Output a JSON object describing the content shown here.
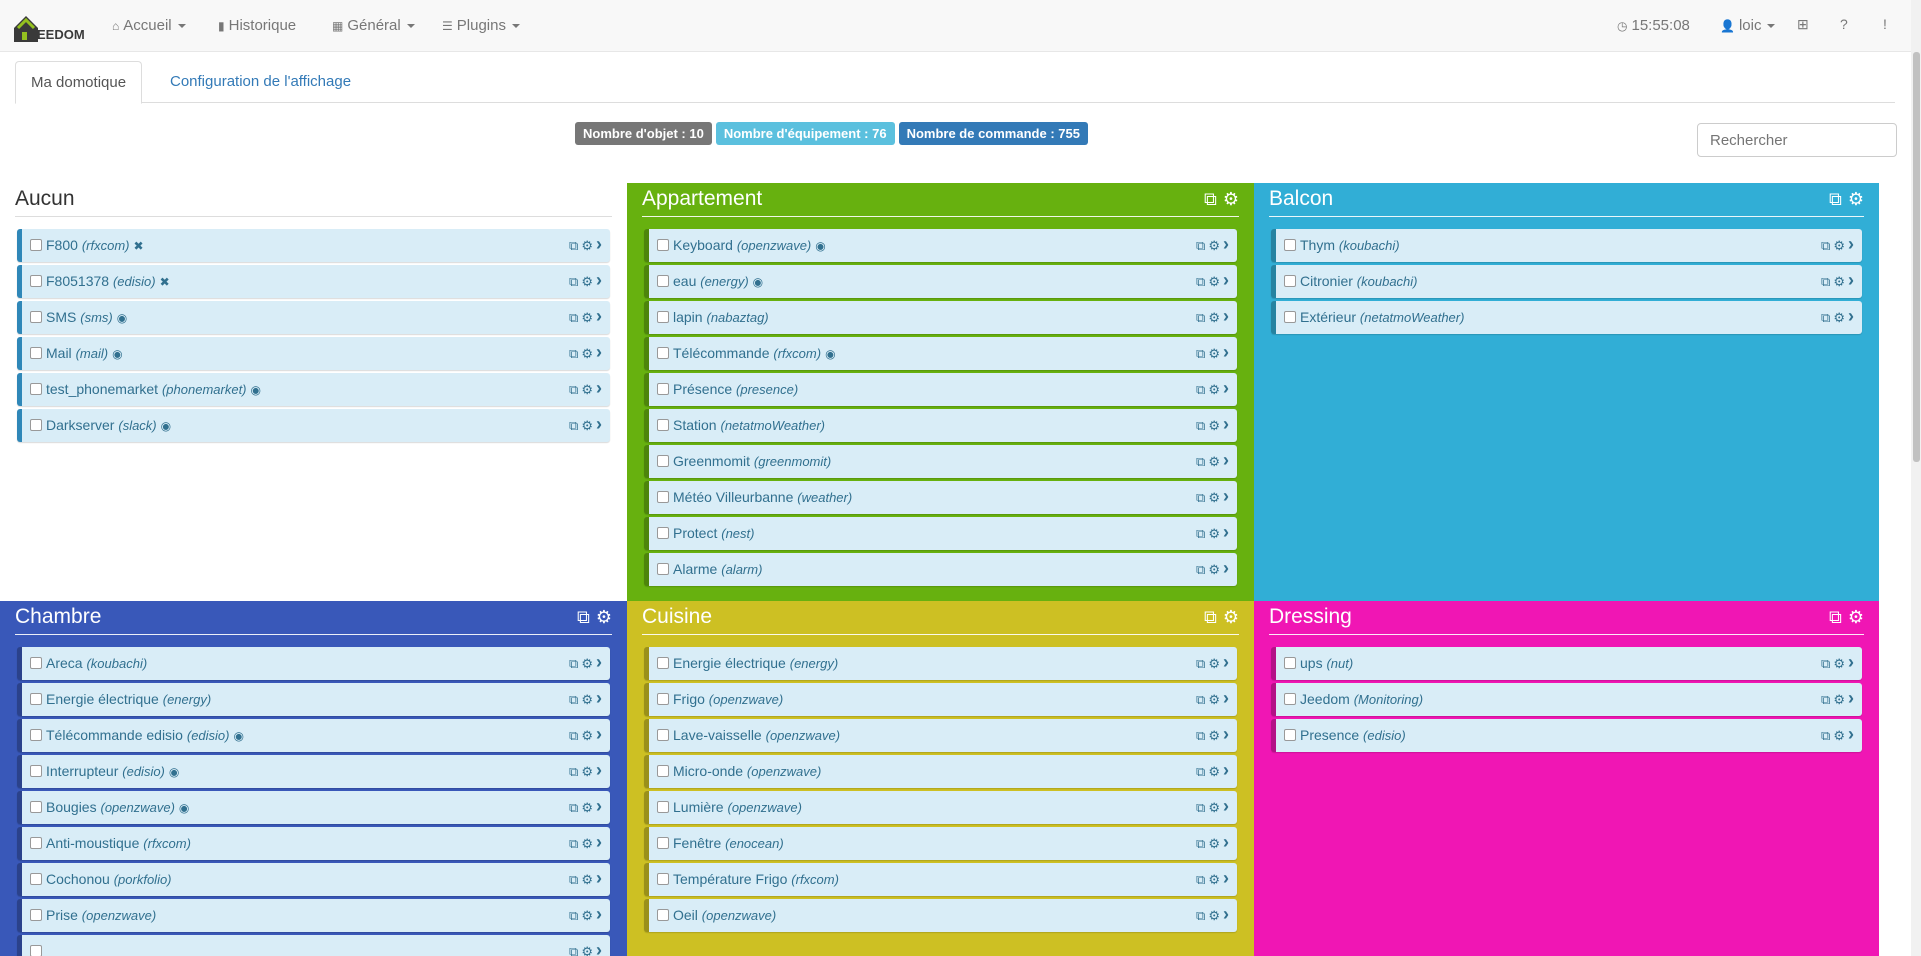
{
  "navbar": {
    "logo_text": "EEDOM",
    "menu": [
      {
        "icon": "home-icon",
        "glyph": "⌂",
        "label": "Accueil",
        "dropdown": true
      },
      {
        "icon": "bar-chart-icon",
        "glyph": "▮",
        "label": "Historique",
        "dropdown": false
      },
      {
        "icon": "dashboard-icon",
        "glyph": "▦",
        "label": "Général",
        "dropdown": true
      },
      {
        "icon": "list-icon",
        "glyph": "☰",
        "label": "Plugins",
        "dropdown": true
      }
    ],
    "clock": "15:55:08",
    "user": "loic"
  },
  "tabs": [
    {
      "label": "Ma domotique",
      "active": true
    },
    {
      "label": "Configuration de l'affichage",
      "active": false
    }
  ],
  "counters": [
    {
      "label": "Nombre d'objet : 10",
      "color": "#777777"
    },
    {
      "label": "Nombre d'équipement : 76",
      "color": "#5bc0de"
    },
    {
      "label": "Nombre de commande : 755",
      "color": "#337ab7"
    }
  ],
  "search": {
    "placeholder": "Rechercher"
  },
  "objects": [
    {
      "name": "Aucun",
      "color": "#ffffff",
      "plain": true,
      "show_head_icons": false,
      "equipments": [
        {
          "name": "F800",
          "type": "(rfxcom)",
          "status": "✖"
        },
        {
          "name": "F8051378",
          "type": "(edisio)",
          "status": "✖"
        },
        {
          "name": "SMS",
          "type": "(sms)",
          "status": "◉"
        },
        {
          "name": "Mail",
          "type": "(mail)",
          "status": "◉"
        },
        {
          "name": "test_phonemarket",
          "type": "(phonemarket)",
          "status": "◉"
        },
        {
          "name": "Darkserver",
          "type": "(slack)",
          "status": "◉"
        }
      ]
    },
    {
      "name": "Appartement",
      "color": "#67b10f",
      "plain": false,
      "show_head_icons": true,
      "equipments": [
        {
          "name": "Keyboard",
          "type": "(openzwave)",
          "status": "◉"
        },
        {
          "name": "eau",
          "type": "(energy)",
          "status": "◉"
        },
        {
          "name": "lapin",
          "type": "(nabaztag)",
          "status": ""
        },
        {
          "name": "Télécommande",
          "type": "(rfxcom)",
          "status": "◉"
        },
        {
          "name": "Présence",
          "type": "(presence)",
          "status": ""
        },
        {
          "name": "Station",
          "type": "(netatmoWeather)",
          "status": ""
        },
        {
          "name": "Greenmomit",
          "type": "(greenmomit)",
          "status": ""
        },
        {
          "name": "Météo Villeurbanne",
          "type": "(weather)",
          "status": ""
        },
        {
          "name": "Protect",
          "type": "(nest)",
          "status": ""
        },
        {
          "name": "Alarme",
          "type": "(alarm)",
          "status": ""
        }
      ]
    },
    {
      "name": "Balcon",
      "color": "#31aed6",
      "plain": false,
      "show_head_icons": true,
      "equipments": [
        {
          "name": "Thym",
          "type": "(koubachi)",
          "status": ""
        },
        {
          "name": "Citronier",
          "type": "(koubachi)",
          "status": ""
        },
        {
          "name": "Extérieur",
          "type": "(netatmoWeather)",
          "status": ""
        }
      ]
    },
    {
      "name": "Chambre",
      "color": "#3958b9",
      "plain": false,
      "show_head_icons": true,
      "equipments": [
        {
          "name": "Areca",
          "type": "(koubachi)",
          "status": ""
        },
        {
          "name": "Energie électrique",
          "type": "(energy)",
          "status": ""
        },
        {
          "name": "Télécommande edisio",
          "type": "(edisio)",
          "status": "◉"
        },
        {
          "name": "Interrupteur",
          "type": "(edisio)",
          "status": "◉"
        },
        {
          "name": "Bougies",
          "type": "(openzwave)",
          "status": "◉"
        },
        {
          "name": "Anti-moustique",
          "type": "(rfxcom)",
          "status": ""
        },
        {
          "name": "Cochonou",
          "type": "(porkfolio)",
          "status": ""
        },
        {
          "name": "Prise",
          "type": "(openzwave)",
          "status": ""
        },
        {
          "name": "",
          "type": "",
          "status": ""
        }
      ]
    },
    {
      "name": "Cuisine",
      "color": "#cdc023",
      "plain": false,
      "show_head_icons": true,
      "equipments": [
        {
          "name": "Energie électrique",
          "type": "(energy)",
          "status": ""
        },
        {
          "name": "Frigo",
          "type": "(openzwave)",
          "status": ""
        },
        {
          "name": "Lave-vaisselle",
          "type": "(openzwave)",
          "status": ""
        },
        {
          "name": "Micro-onde",
          "type": "(openzwave)",
          "status": ""
        },
        {
          "name": "Lumière",
          "type": "(openzwave)",
          "status": ""
        },
        {
          "name": "Fenêtre",
          "type": "(enocean)",
          "status": ""
        },
        {
          "name": "Température Frigo",
          "type": "(rfxcom)",
          "status": ""
        },
        {
          "name": "Oeil",
          "type": "(openzwave)",
          "status": ""
        }
      ]
    },
    {
      "name": "Dressing",
      "color": "#f016b4",
      "plain": false,
      "show_head_icons": true,
      "equipments": [
        {
          "name": "ups",
          "type": "(nut)",
          "status": ""
        },
        {
          "name": "Jeedom",
          "type": "(Monitoring)",
          "status": ""
        },
        {
          "name": "Presence",
          "type": "(edisio)",
          "status": ""
        }
      ]
    }
  ]
}
